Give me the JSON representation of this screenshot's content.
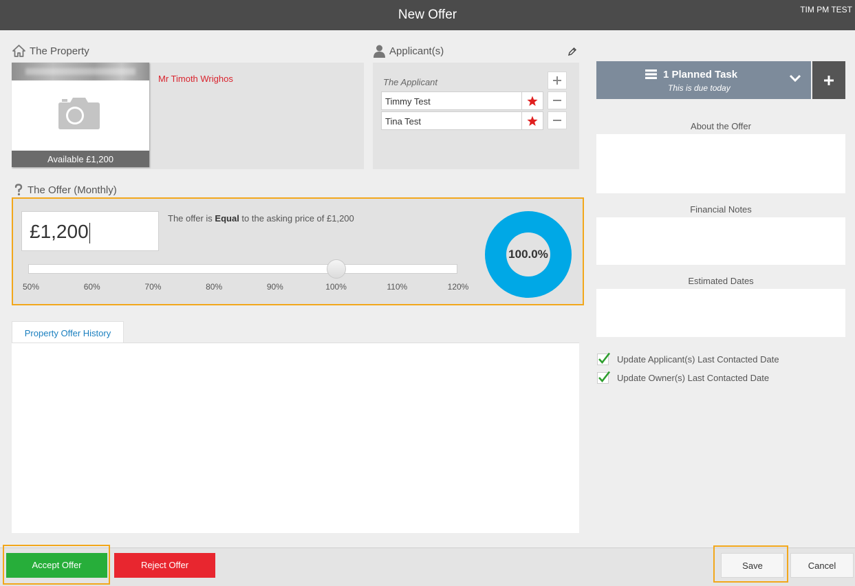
{
  "window": {
    "title": "New Offer",
    "user": "TIM PM TEST"
  },
  "property": {
    "heading": "The Property",
    "availability": "Available £1,200",
    "owner": "Mr Timoth Wrighos"
  },
  "applicants": {
    "heading": "Applicant(s)",
    "caption": "The Applicant",
    "items": [
      {
        "name": "Timmy Test"
      },
      {
        "name": "Tina Test"
      }
    ]
  },
  "offer": {
    "heading": "The Offer (Monthly)",
    "amount": "£1,200",
    "description_prefix": "The offer is ",
    "comparison": "Equal",
    "description_suffix": " to the asking price of £1,200",
    "slider_value_percent": 100,
    "slider_ticks": [
      "50%",
      "60%",
      "70%",
      "80%",
      "90%",
      "100%",
      "110%",
      "120%"
    ],
    "donut_percent": "100.0%"
  },
  "history": {
    "tab_label": "Property Offer History"
  },
  "task": {
    "title": "1 Planned Task",
    "subtitle": "This is due today"
  },
  "side": {
    "about_label": "About the Offer",
    "financial_label": "Financial Notes",
    "dates_label": "Estimated Dates",
    "checks": [
      {
        "label": "Update Applicant(s) Last Contacted Date",
        "checked": true
      },
      {
        "label": "Update Owner(s) Last Contacted Date",
        "checked": true
      }
    ]
  },
  "footer": {
    "accept_label": "Accept Offer",
    "reject_label": "Reject Offer",
    "save_label": "Save",
    "cancel_label": "Cancel"
  },
  "colors": {
    "accent_orange": "#f2a71b",
    "accept_green": "#27ae3a",
    "reject_red": "#e8262f",
    "donut_blue": "#00a8e6",
    "task_slate": "#7d8b9b",
    "link_blue": "#1a7fbf",
    "owner_red": "#d9232d"
  }
}
